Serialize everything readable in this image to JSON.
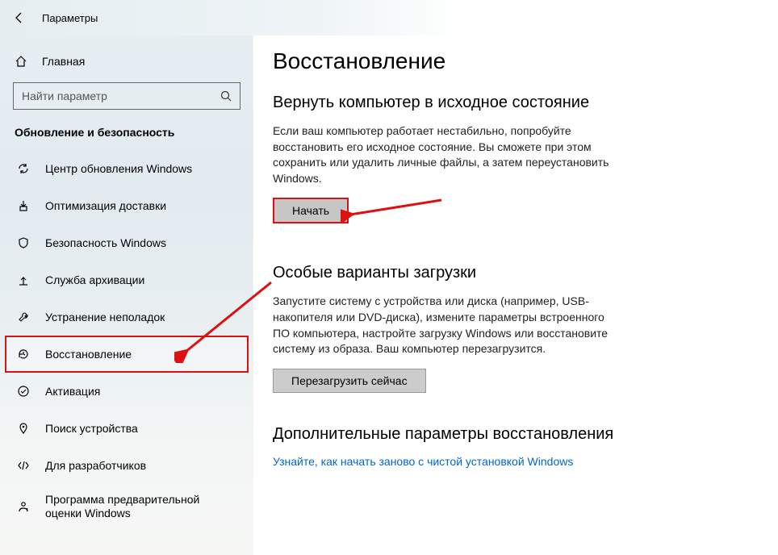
{
  "header": {
    "title": "Параметры"
  },
  "sidebar": {
    "home": "Главная",
    "search_placeholder": "Найти параметр",
    "section": "Обновление и безопасность",
    "items": [
      {
        "label": "Центр обновления Windows"
      },
      {
        "label": "Оптимизация доставки"
      },
      {
        "label": "Безопасность Windows"
      },
      {
        "label": "Служба архивации"
      },
      {
        "label": "Устранение неполадок"
      },
      {
        "label": "Восстановление"
      },
      {
        "label": "Активация"
      },
      {
        "label": "Поиск устройства"
      },
      {
        "label": "Для разработчиков"
      },
      {
        "label": "Программа предварительной оценки Windows"
      }
    ]
  },
  "content": {
    "title": "Восстановление",
    "reset": {
      "heading": "Вернуть компьютер в исходное состояние",
      "text": "Если ваш компьютер работает нестабильно, попробуйте восстановить его исходное состояние. Вы сможете при этом сохранить или удалить личные файлы, а затем переустановить Windows.",
      "button": "Начать"
    },
    "advanced": {
      "heading": "Особые варианты загрузки",
      "text": "Запустите систему с устройства или диска (например, USB-накопителя или DVD-диска), измените параметры встроенного ПО компьютера, настройте загрузку Windows или восстановите систему из образа. Ваш компьютер перезагрузится.",
      "button": "Перезагрузить сейчас"
    },
    "more": {
      "heading": "Дополнительные параметры восстановления",
      "link": "Узнайте, как начать заново с чистой установкой Windows"
    }
  }
}
